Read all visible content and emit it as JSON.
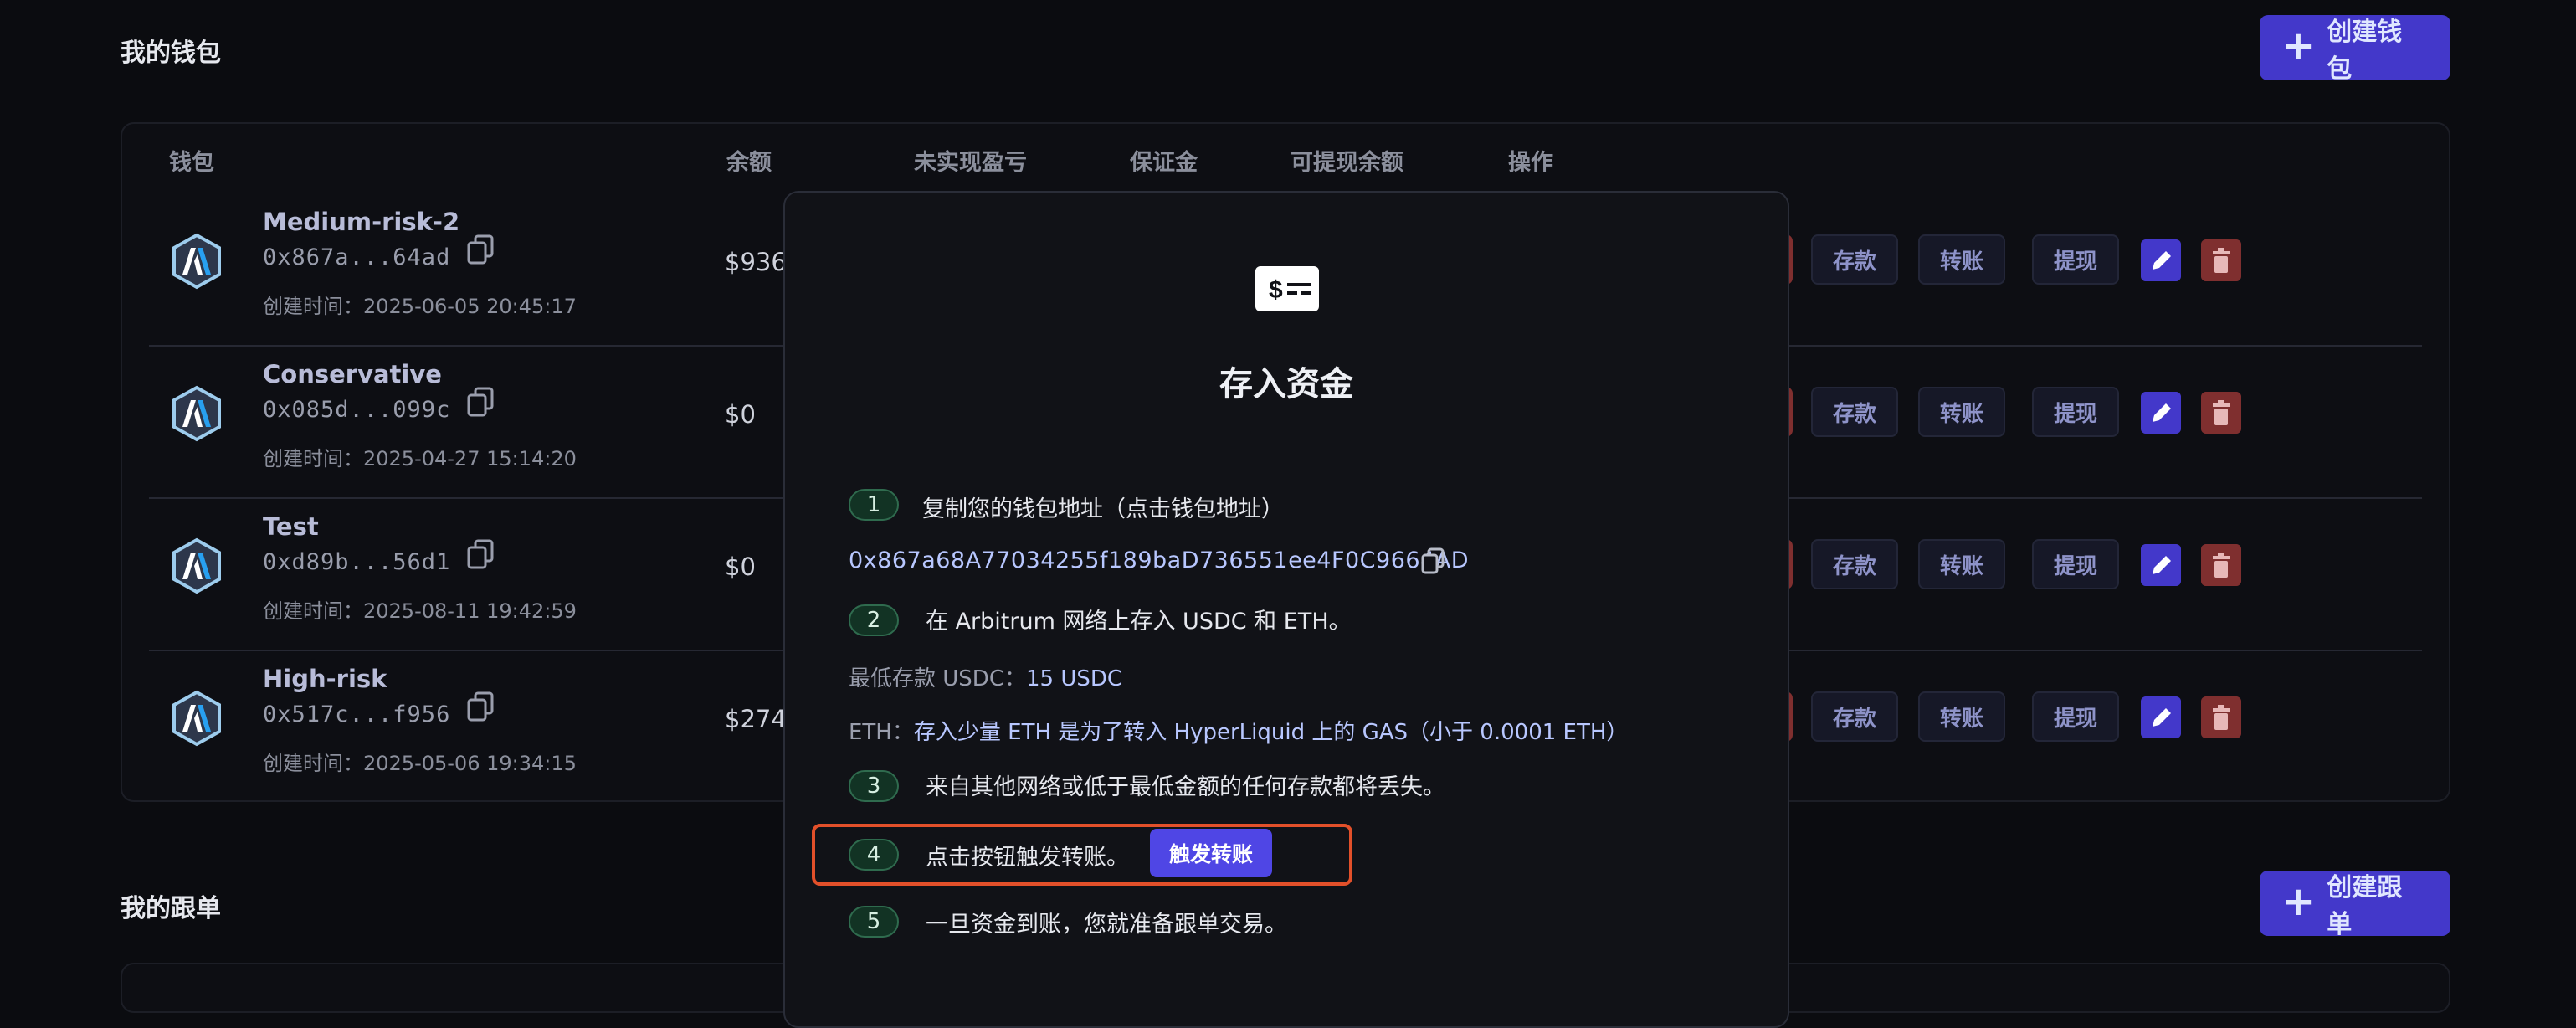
{
  "wallets_section": {
    "title": "我的钱包",
    "create_button": "创建钱包",
    "columns": [
      "钱包",
      "余额",
      "未实现盈亏",
      "保证金",
      "可提现余额",
      "操作"
    ],
    "rows": [
      {
        "name": "Medium-risk-2",
        "address": "0x867a...64ad",
        "created": "创建时间：2025-06-05 20:45:17",
        "balance": "$936"
      },
      {
        "name": "Conservative",
        "address": "0x085d...099c",
        "created": "创建时间：2025-04-27 15:14:20",
        "balance": "$0"
      },
      {
        "name": "Test",
        "address": "0xd89b...56d1",
        "created": "创建时间：2025-08-11 19:42:59",
        "balance": "$0"
      },
      {
        "name": "High-risk",
        "address": "0x517c...f956",
        "created": "创建时间：2025-05-06 19:34:15",
        "balance": "$274"
      }
    ],
    "actions": {
      "deposit": "存款",
      "transfer": "转账",
      "withdraw": "提现"
    }
  },
  "follow_section": {
    "title": "我的跟单",
    "create_button": "创建跟单"
  },
  "modal": {
    "title": "存入资金",
    "steps": [
      {
        "num": "1",
        "text": "复制您的钱包地址（点击钱包地址）"
      },
      {
        "num": "2",
        "text": "在 Arbitrum 网络上存入 USDC 和 ETH。"
      },
      {
        "num": "3",
        "text": "来自其他网络或低于最低金额的任何存款都将丢失。"
      },
      {
        "num": "4",
        "text": "点击按钮触发转账。"
      },
      {
        "num": "5",
        "text": "一旦资金到账，您就准备跟单交易。"
      }
    ],
    "address": "0x867a68A77034255f189baD736551ee4F0C9664AD",
    "min_usdc_label": "最低存款 USDC：",
    "min_usdc_value": "15 USDC",
    "eth_label": "ETH：",
    "eth_value": "存入少量 ETH 是为了转入 HyperLiquid 上的 GAS（小于 0.0001 ETH）",
    "trigger_button": "触发转账"
  },
  "colors": {
    "accent": "#4338ca",
    "danger": "#7f2f2f",
    "highlight": "#e2502a",
    "step_badge": "#123324"
  }
}
